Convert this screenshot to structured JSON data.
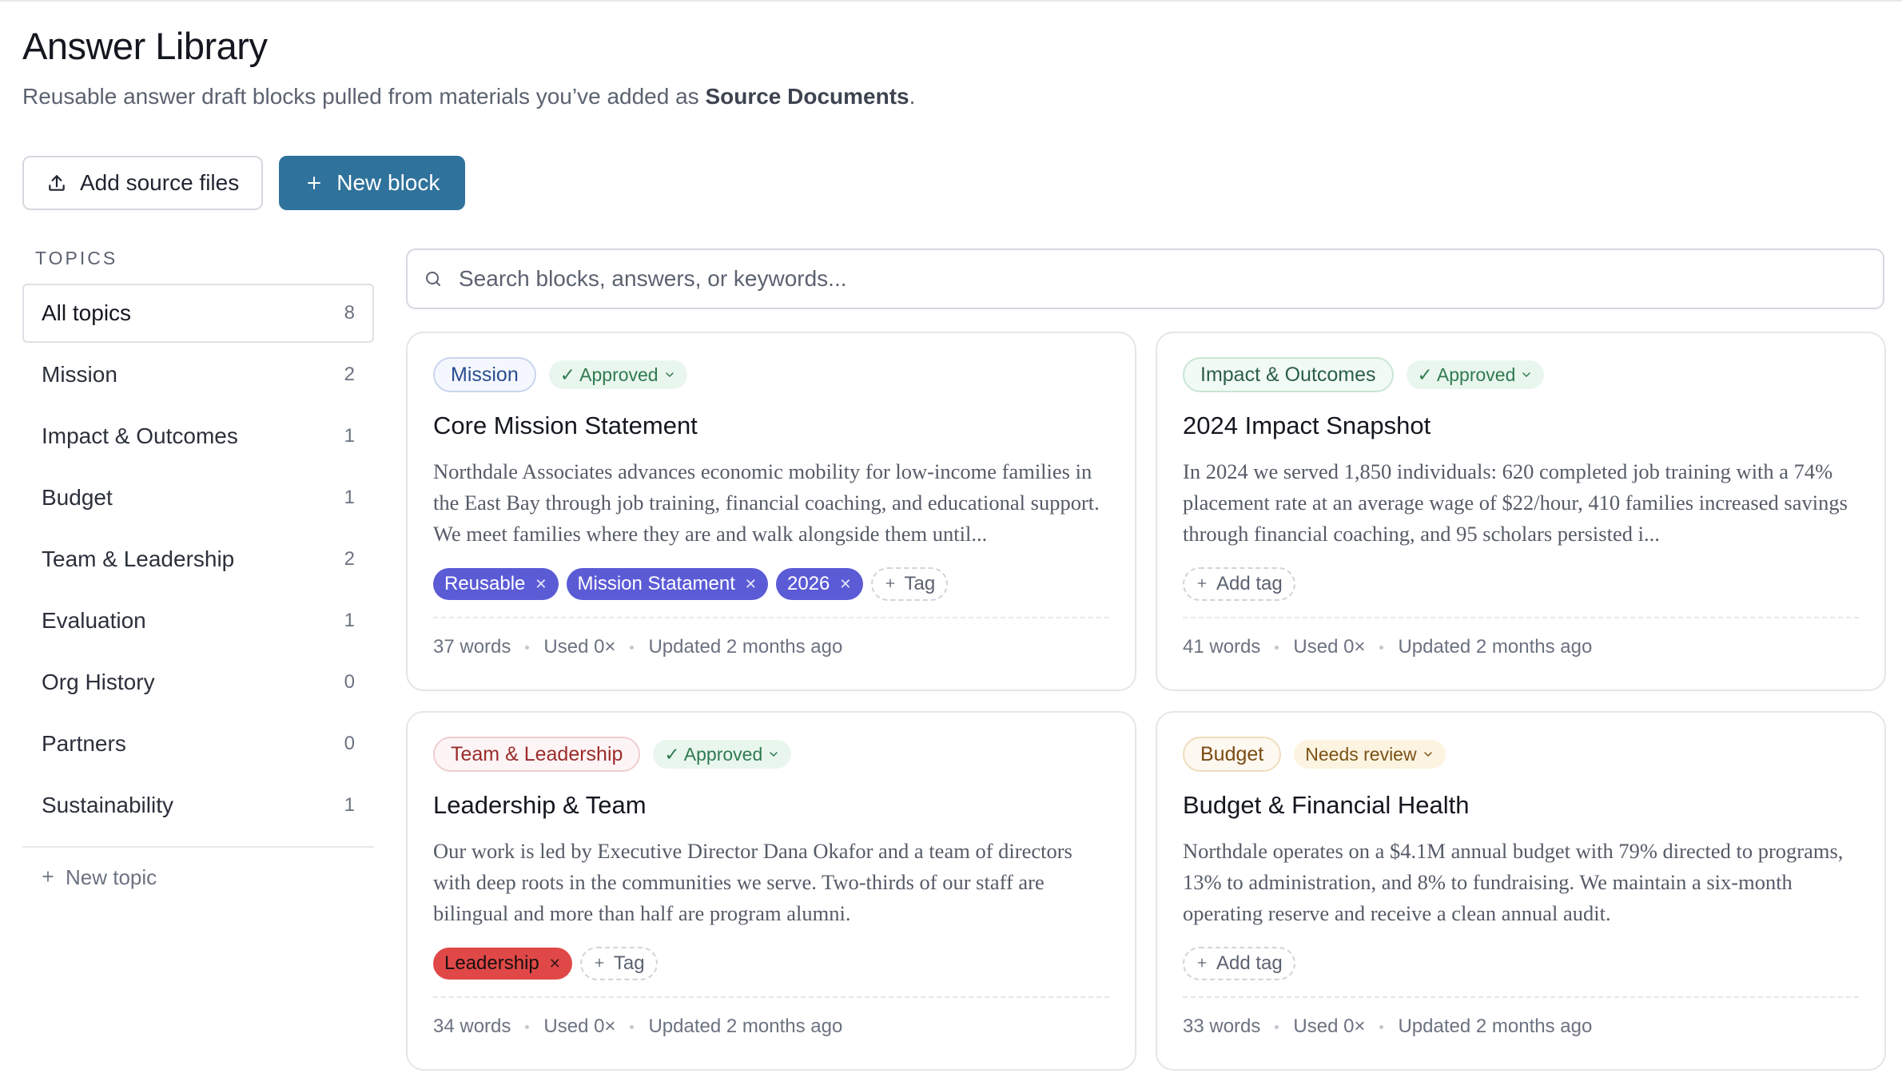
{
  "header": {
    "title": "Answer Library",
    "subtitle_prefix": "Reusable answer draft blocks pulled from materials you’ve added as",
    "subtitle_emphasis": "Source Documents",
    "subtitle_suffix": "."
  },
  "actions": {
    "add_source_label": "Add source files",
    "new_block_label": "New block"
  },
  "sidebar": {
    "heading": "TOPICS",
    "topics": [
      {
        "label": "All topics",
        "count": "8"
      },
      {
        "label": "Mission",
        "count": "2"
      },
      {
        "label": "Impact & Outcomes",
        "count": "1"
      },
      {
        "label": "Budget",
        "count": "1"
      },
      {
        "label": "Team & Leadership",
        "count": "2"
      },
      {
        "label": "Evaluation",
        "count": "1"
      },
      {
        "label": "Org History",
        "count": "0"
      },
      {
        "label": "Partners",
        "count": "0"
      },
      {
        "label": "Sustainability",
        "count": "1"
      }
    ],
    "new_topic_label": "New topic"
  },
  "search": {
    "placeholder": "Search blocks, answers, or keywords..."
  },
  "colors": {
    "primary": "#2f729b",
    "tag_indigo": "#5b5bd6",
    "tag_red": "#e04848",
    "approved": "#2f7a4f",
    "needs_review": "#7a5214"
  },
  "cards": [
    {
      "topic": "Mission",
      "status": "✓ Approved",
      "title": "Core Mission Statement",
      "body": "Northdale Associates advances economic mobility for low-income families in the East Bay through job training, financial coaching, and educational support. We meet families where they are and walk alongside them until...",
      "tags": [
        "Reusable",
        "Mission Statament",
        "2026"
      ],
      "add_tag_label": "Tag",
      "words": "37 words",
      "used": "Used 0×",
      "updated": "Updated 2 months ago"
    },
    {
      "topic": "Impact & Outcomes",
      "status": "✓ Approved",
      "title": "2024 Impact Snapshot",
      "body": "In 2024 we served 1,850 individuals: 620 completed job training with a 74% placement rate at an average wage of $22/hour, 410 families increased savings through financial coaching, and 95 scholars persisted i...",
      "tags": [],
      "add_tag_label": "Add tag",
      "words": "41 words",
      "used": "Used 0×",
      "updated": "Updated 2 months ago"
    },
    {
      "topic": "Team & Leadership",
      "status": "✓ Approved",
      "title": "Leadership & Team",
      "body": "Our work is led by Executive Director Dana Okafor and a team of directors with deep roots in the communities we serve. Two-thirds of our staff are bilingual and more than half are program alumni.",
      "tags": [
        "Leadership"
      ],
      "add_tag_label": "Tag",
      "words": "34 words",
      "used": "Used 0×",
      "updated": "Updated 2 months ago"
    },
    {
      "topic": "Budget",
      "status": "Needs review",
      "title": "Budget & Financial Health",
      "body": "Northdale operates on a $4.1M annual budget with 79% directed to programs, 13% to administration, and 8% to fundraising. We maintain a six-month operating reserve and receive a clean annual audit.",
      "tags": [],
      "add_tag_label": "Add tag",
      "words": "33 words",
      "used": "Used 0×",
      "updated": "Updated 2 months ago"
    }
  ]
}
